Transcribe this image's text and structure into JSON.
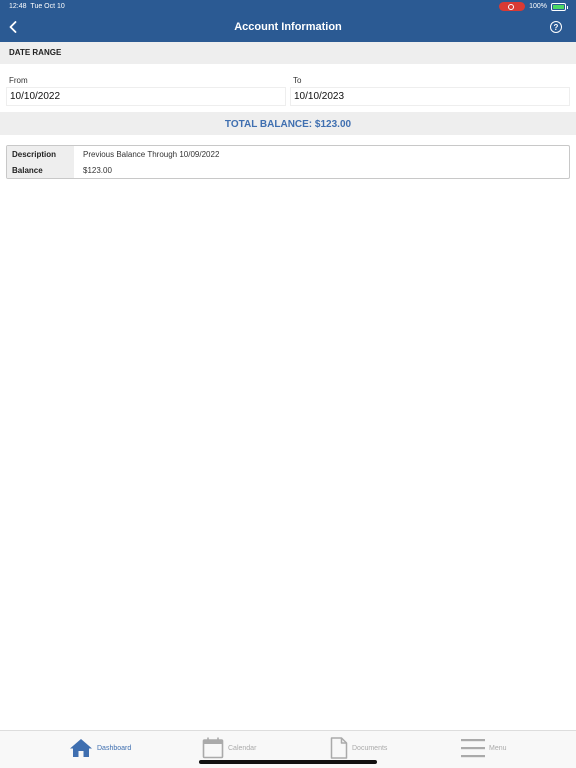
{
  "status_bar": {
    "time": "12:48",
    "date": "Tue Oct 10",
    "battery": "100%"
  },
  "header": {
    "title": "Account Information",
    "help_label": "?"
  },
  "date_range": {
    "section_title": "DATE RANGE",
    "from_label": "From",
    "from_value": "10/10/2022",
    "to_label": "To",
    "to_value": "10/10/2023"
  },
  "total": {
    "text": "TOTAL BALANCE: $123.00"
  },
  "details": [
    {
      "label": "Description",
      "value": "Previous Balance Through 10/09/2022"
    },
    {
      "label": "Balance",
      "value": "$123.00"
    }
  ],
  "tab_bar": {
    "tabs": [
      {
        "label": "Dashboard",
        "icon": "home-icon",
        "active": true
      },
      {
        "label": "Calendar",
        "icon": "calendar-icon",
        "active": false
      },
      {
        "label": "Documents",
        "icon": "document-icon",
        "active": false
      },
      {
        "label": "Menu",
        "icon": "menu-icon",
        "active": false
      }
    ]
  },
  "colors": {
    "header": "#2b5a93",
    "accent": "#3f6fb0",
    "section_bg": "#eeeeee",
    "inactive": "#aaaaaa"
  }
}
